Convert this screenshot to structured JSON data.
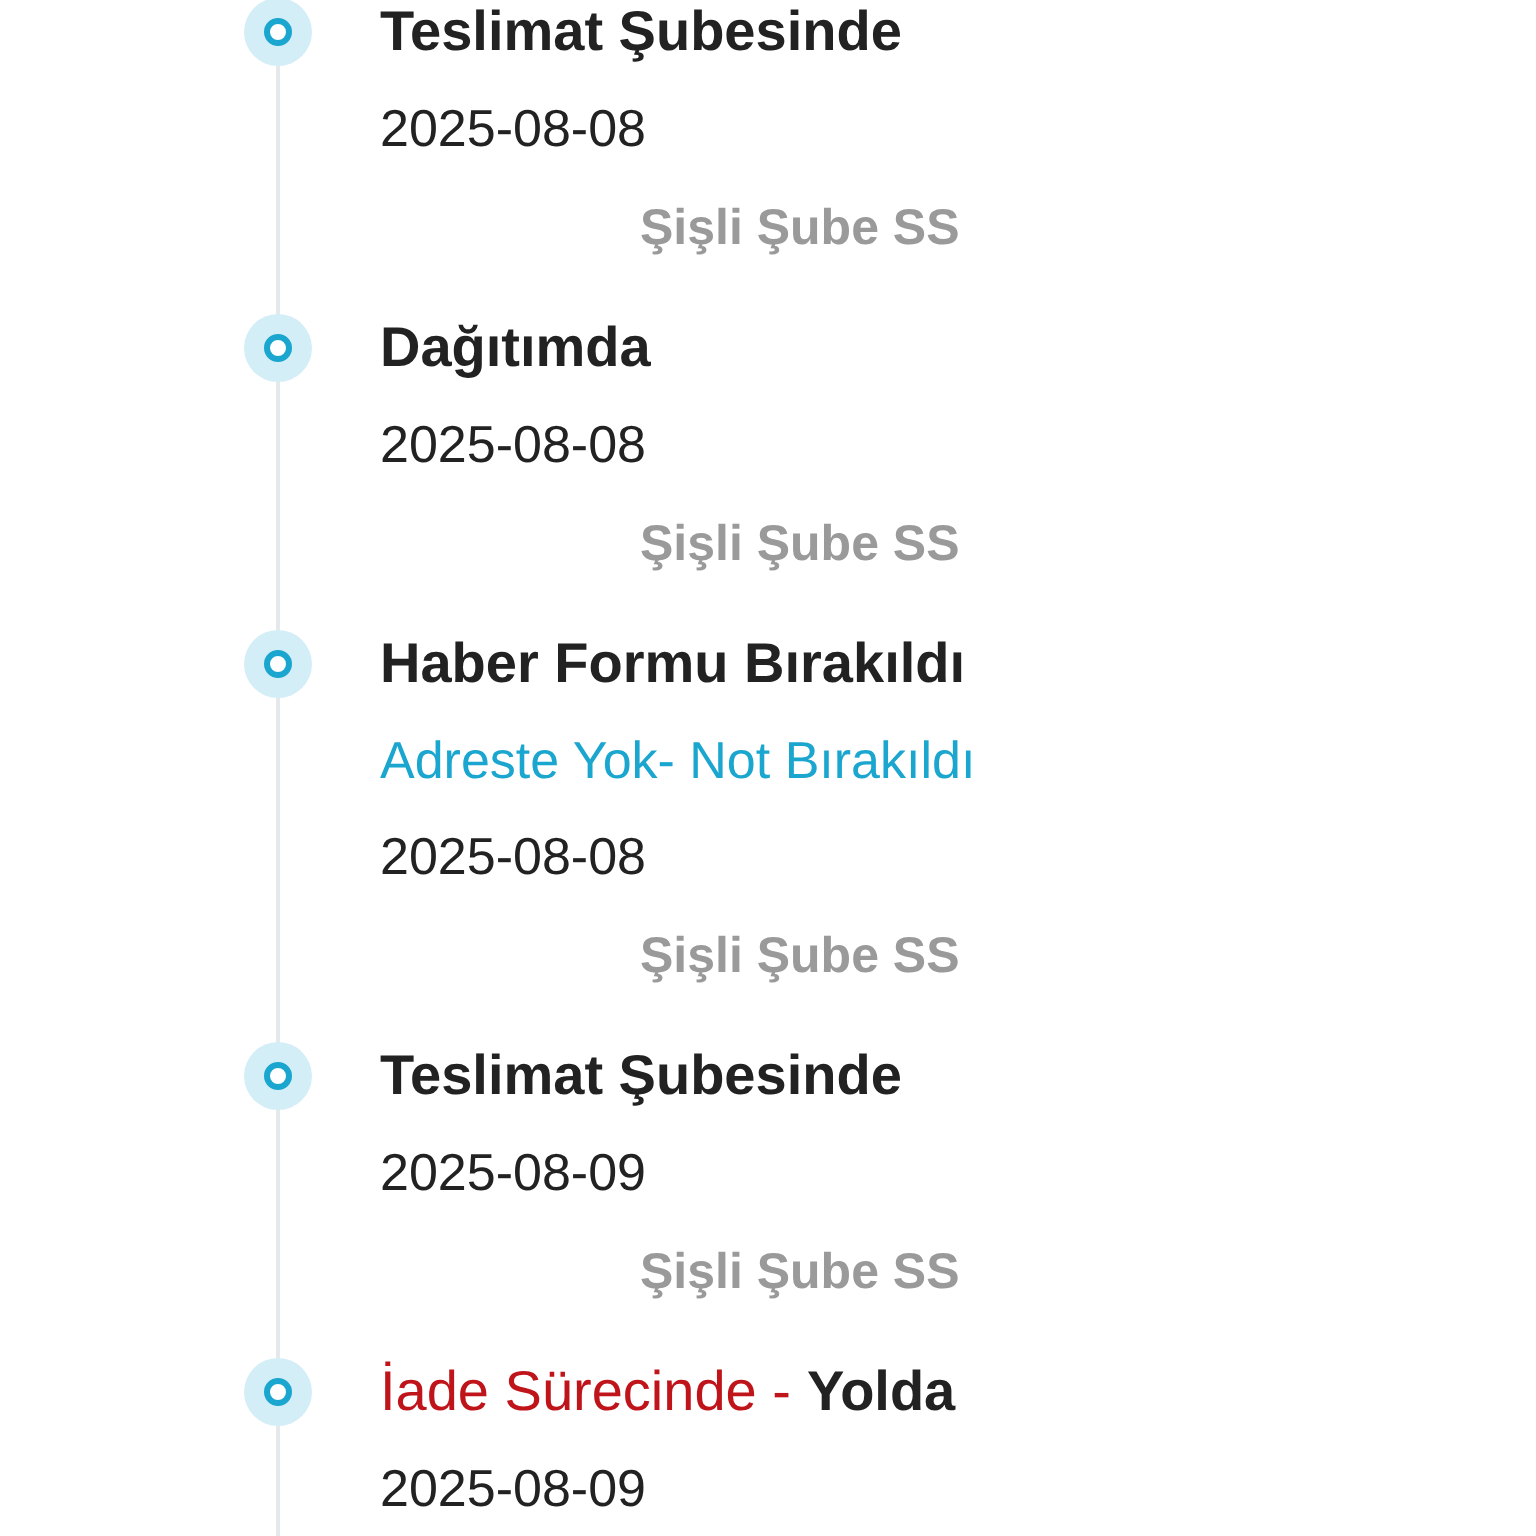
{
  "events": [
    {
      "title": "Teslimat Şubesinde",
      "date": "2025-08-08",
      "branch": "Şişli Şube SS"
    },
    {
      "title": "Dağıtımda",
      "date": "2025-08-08",
      "branch": "Şişli Şube SS"
    },
    {
      "title": "Haber Formu Bırakıldı",
      "note": "Adreste Yok- Not Bırakıldı",
      "date": "2025-08-08",
      "branch": "Şişli Şube SS"
    },
    {
      "title": "Teslimat Şubesinde",
      "date": "2025-08-09",
      "branch": "Şişli Şube SS"
    },
    {
      "prefix": "İade Sürecinde -",
      "title": "Yolda",
      "date": "2025-08-09"
    }
  ]
}
